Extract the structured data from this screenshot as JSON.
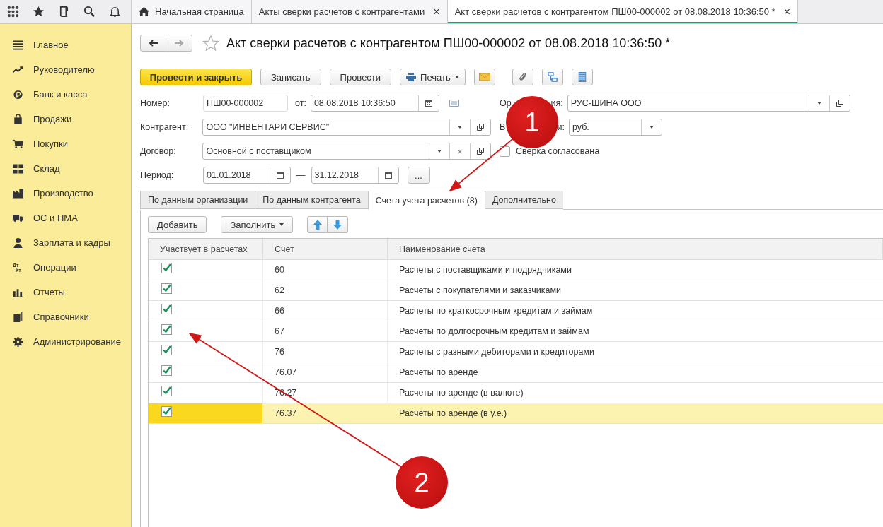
{
  "open_tabs": [
    {
      "label": "Начальная страница",
      "kind": "home",
      "selected": false
    },
    {
      "label": "Акты сверки расчетов с контрагентами",
      "kind": "closable",
      "selected": false
    },
    {
      "label": "Акт сверки расчетов с контрагентом ПШ00-000002 от 08.08.2018 10:36:50 *",
      "kind": "closable",
      "selected": true
    }
  ],
  "close_glyph": "×",
  "sidebar": {
    "items": [
      {
        "label": "Главное"
      },
      {
        "label": "Руководителю"
      },
      {
        "label": "Банк и касса"
      },
      {
        "label": "Продажи"
      },
      {
        "label": "Покупки"
      },
      {
        "label": "Склад"
      },
      {
        "label": "Производство"
      },
      {
        "label": "ОС и НМА"
      },
      {
        "label": "Зарплата и кадры"
      },
      {
        "label": "Операции"
      },
      {
        "label": "Отчеты"
      },
      {
        "label": "Справочники"
      },
      {
        "label": "Администрирование"
      }
    ]
  },
  "dtkt": [
    "Дт",
    "Кт"
  ],
  "document": {
    "title": "Акт сверки расчетов с контрагентом ПШ00-000002 от 08.08.2018 10:36:50 *",
    "buttons": [
      {
        "label": "Провести и закрыть",
        "kind": "primary"
      },
      {
        "label": "Записать",
        "kind": "plain"
      },
      {
        "label": "Провести",
        "kind": "plain"
      },
      {
        "label": "Печать",
        "kind": "print"
      }
    ],
    "number": {
      "label": "Номер:",
      "value": "ПШ00-000002"
    },
    "date": {
      "label": "от:",
      "value": "08.08.2018 10:36:50"
    },
    "organization": {
      "label_parts": [
        "Ор",
        "ия:"
      ],
      "value": "РУС-ШИНА ООО"
    },
    "counterparty": {
      "label": "Контрагент:",
      "value": "ООО \"ИНВЕНТАРИ СЕРВИС\""
    },
    "currency": {
      "label_parts": [
        "В",
        "и:"
      ],
      "value": "руб."
    },
    "contract": {
      "label": "Договор:",
      "value": "Основной с поставщиком"
    },
    "agreed": {
      "label": "Сверка согласована",
      "checked": false
    },
    "period": {
      "label": "Период:",
      "from": "01.01.2018",
      "dash": "—",
      "to": "31.12.2018",
      "more": "..."
    },
    "tabs": [
      {
        "label": "По данным организации",
        "selected": false
      },
      {
        "label": "По данным контрагента",
        "selected": false
      },
      {
        "label": "Счета учета расчетов (8)",
        "selected": true
      },
      {
        "label": "Дополнительно",
        "selected": false
      }
    ],
    "table_toolbar": {
      "add": "Добавить",
      "fill": "Заполнить"
    },
    "table": {
      "columns": [
        "Участвует в расчетах",
        "Счет",
        "Наименование счета"
      ],
      "rows": [
        {
          "checked": true,
          "account": "60",
          "name": "Расчеты с поставщиками и подрядчиками",
          "selected": false
        },
        {
          "checked": true,
          "account": "62",
          "name": "Расчеты с покупателями и заказчиками",
          "selected": false
        },
        {
          "checked": true,
          "account": "66",
          "name": "Расчеты по краткосрочным кредитам и займам",
          "selected": false
        },
        {
          "checked": true,
          "account": "67",
          "name": "Расчеты по долгосрочным кредитам и займам",
          "selected": false
        },
        {
          "checked": true,
          "account": "76",
          "name": "Расчеты с разными дебиторами и кредиторами",
          "selected": false
        },
        {
          "checked": true,
          "account": "76.07",
          "name": "Расчеты по аренде",
          "selected": false
        },
        {
          "checked": true,
          "account": "76.27",
          "name": "Расчеты по аренде (в валюте)",
          "selected": false
        },
        {
          "checked": true,
          "account": "76.37",
          "name": "Расчеты по аренде (в у.е.)",
          "selected": true
        }
      ]
    }
  },
  "annotations": [
    {
      "label": "1"
    },
    {
      "label": "2"
    }
  ]
}
